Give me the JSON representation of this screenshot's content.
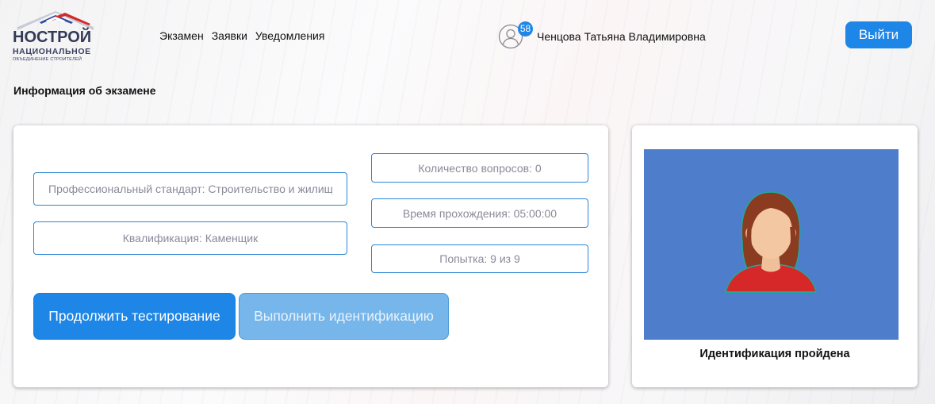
{
  "logo": {
    "brand": "НОСТРОЙ",
    "line1": "НАЦИОНАЛЬНОЕ",
    "line2": "ОБЪЕДИНЕНИЕ СТРОИТЕЛЕЙ"
  },
  "nav": {
    "items": [
      "Экзамен",
      "Заявки",
      "Уведомления"
    ]
  },
  "user": {
    "notifications": "58",
    "name": "Ченцова Татьяна Владимировна"
  },
  "logout_label": "Выйти",
  "page_title": "Информация об экзамене",
  "exam": {
    "standard": "Профессиональный стандарт: Строительство и жилищно-коммунальное хозяйство",
    "qualification": "Квалификация: Каменщик",
    "question_count": "Количество вопросов: 0",
    "duration": "Время прохождения: 05:00:00",
    "attempt": "Попытка: 9 из 9"
  },
  "buttons": {
    "continue": "Продолжить тестирование",
    "identify": "Выполнить идентификацию"
  },
  "identification": {
    "status": "Идентификация пройдена"
  },
  "colors": {
    "accent": "#1d86e6",
    "accent_disabled": "#76b6ea",
    "photo_bg": "#4e7ecb",
    "field_border": "#2a87d6"
  },
  "icons": [
    "user-avatar-icon",
    "female-avatar-icon"
  ]
}
